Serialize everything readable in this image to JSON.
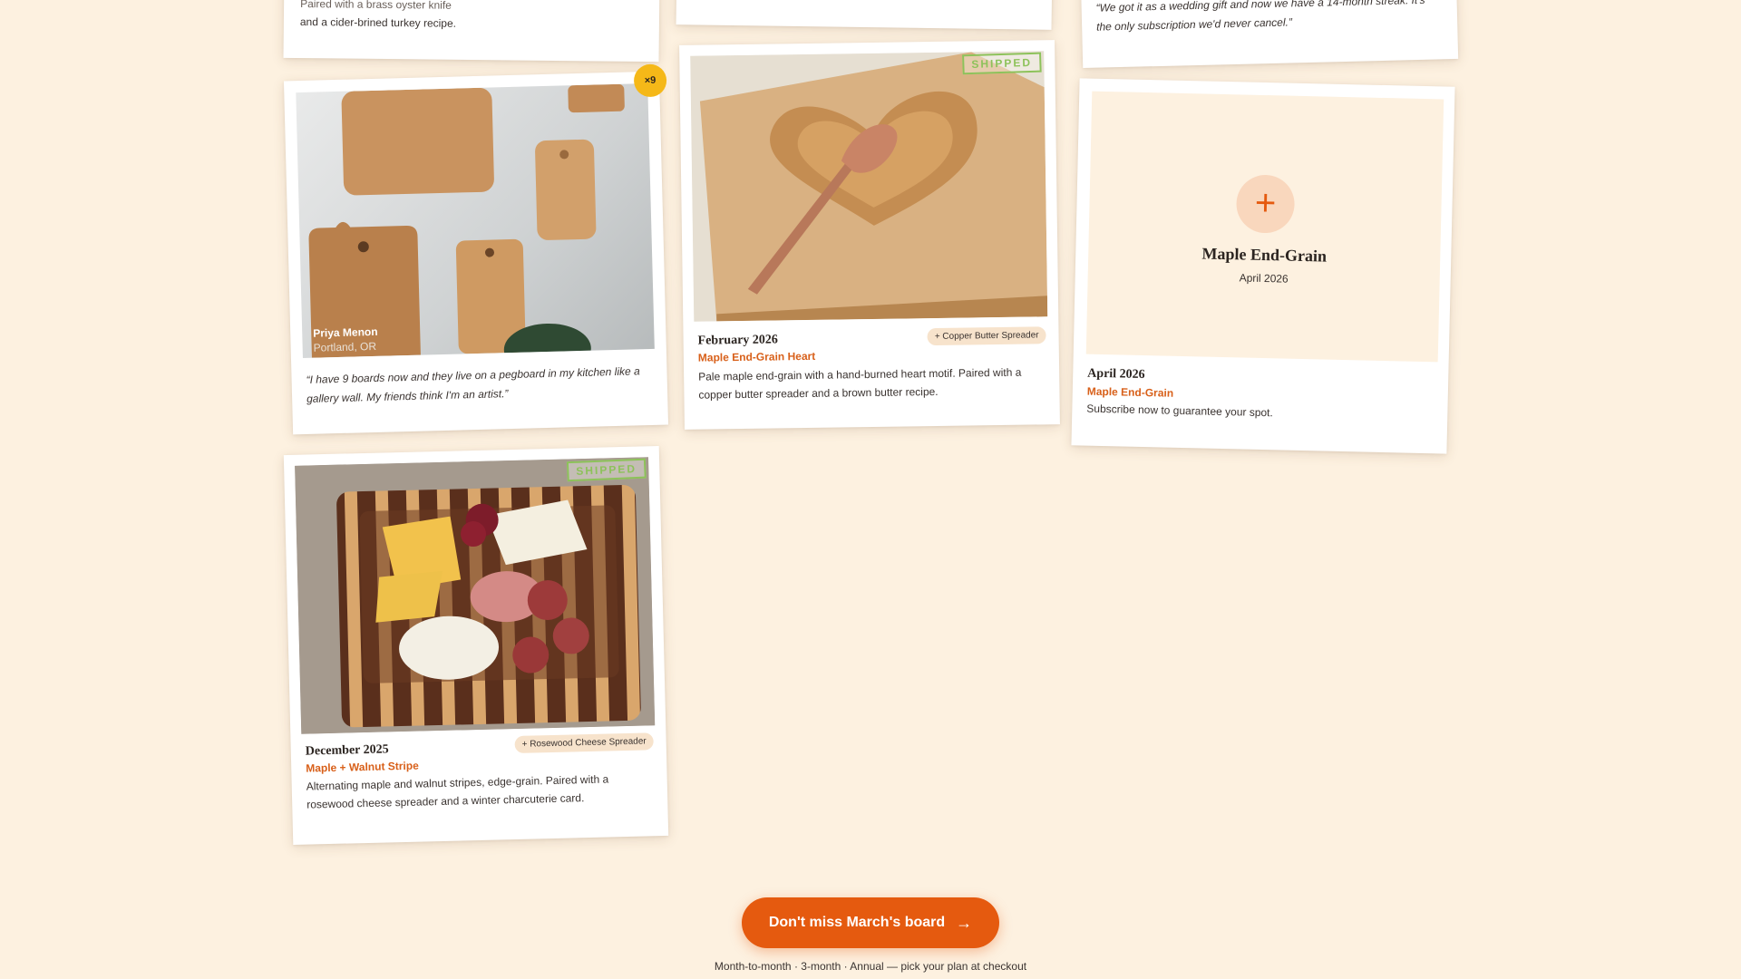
{
  "top_cards": {
    "left_tail": "and a cider-brined turkey recipe.",
    "left_partial": "Paired with a brass oyster knife",
    "right_quote_line1": "“We got it as a wedding gift and now we have a 14-month streak. It's",
    "right_quote_line2": "the only subscription we'd never cancel.”"
  },
  "testimonial": {
    "badge": "×9",
    "name": "Priya Menon",
    "location": "Portland, OR",
    "quote": "“I have 9 boards now and they live on a pegboard in my kitchen like a gallery wall. My friends think I'm an artist.”"
  },
  "feb_card": {
    "stamp": "SHIPPED",
    "date": "February 2026",
    "pairing": "+ Copper Butter Spreader",
    "board": "Maple End-Grain Heart",
    "description": "Pale maple end-grain with a hand-burned heart motif. Paired with a copper butter spreader and a brown butter recipe."
  },
  "april_card": {
    "placeholder_icon": "plus-icon",
    "placeholder_title": "Maple End-Grain",
    "placeholder_date": "April 2026",
    "date": "April 2026",
    "board": "Maple End-Grain",
    "description": "Subscribe now to guarantee your spot."
  },
  "dec_card": {
    "stamp": "SHIPPED",
    "date": "December 2025",
    "pairing": "+ Rosewood Cheese Spreader",
    "board": "Maple + Walnut Stripe",
    "description": "Alternating maple and walnut stripes, edge-grain. Paired with a rosewood cheese spreader and a winter charcuterie card."
  },
  "cta": {
    "label": "Don't miss March's board",
    "icon": "arrow-right-icon",
    "subtext": "Month-to-month · 3-month · Annual — pick your plan at checkout"
  },
  "colors": {
    "background": "#fdf1e0",
    "accent": "#e55a0f",
    "stamp": "#8dc25a",
    "badge": "#f5b818"
  }
}
